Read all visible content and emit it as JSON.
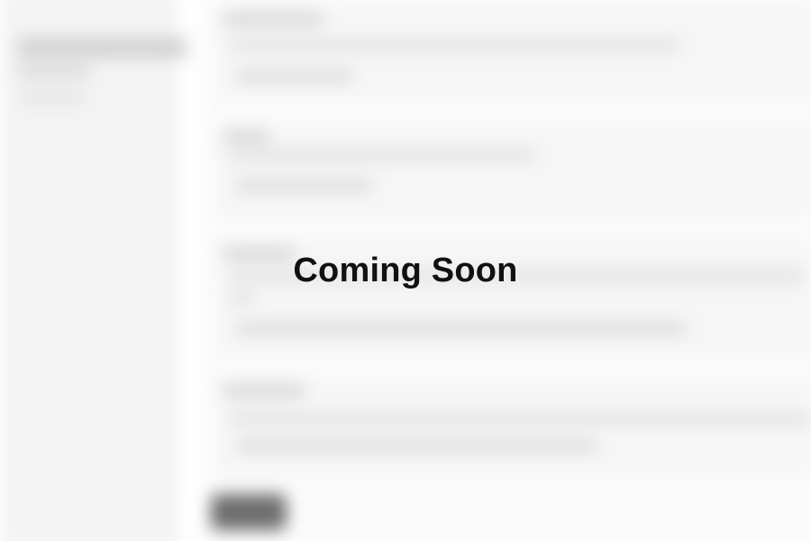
{
  "overlay": {
    "message": "Coming Soon"
  },
  "colors": {
    "background": "#ffffff",
    "sidebar": "#f3f3f3",
    "overlay_text": "#111111",
    "blurred_button": "#6e6e6e"
  }
}
